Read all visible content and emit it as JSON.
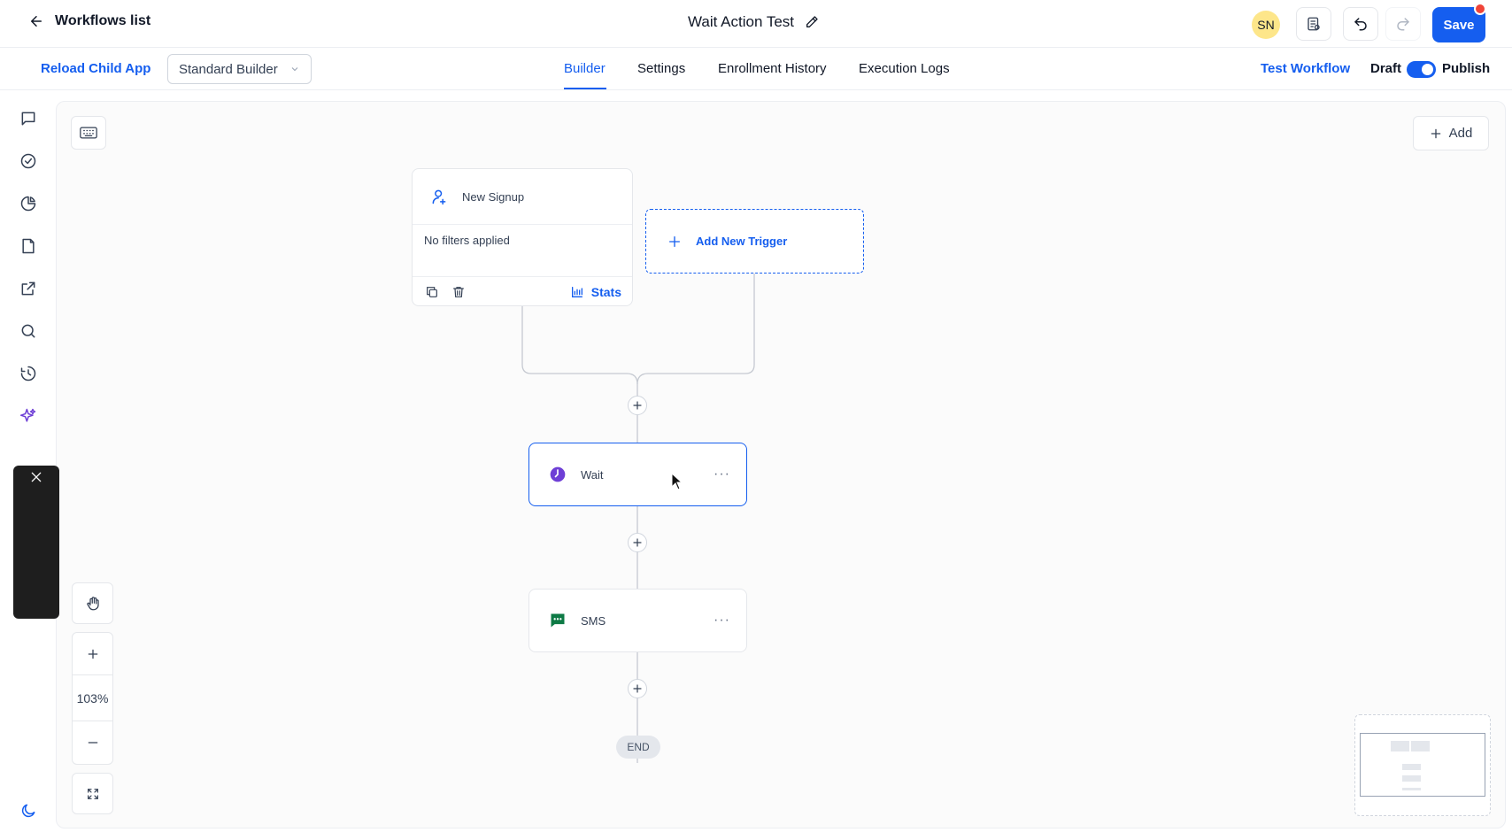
{
  "header": {
    "back_label": "Workflows list",
    "workflow_title": "Wait Action Test",
    "avatar_initials": "SN",
    "save_label": "Save"
  },
  "subbar": {
    "reload_label": "Reload Child App",
    "builder_select_value": "Standard Builder",
    "tabs": [
      {
        "label": "Builder",
        "active": true
      },
      {
        "label": "Settings",
        "active": false
      },
      {
        "label": "Enrollment History",
        "active": false
      },
      {
        "label": "Execution Logs",
        "active": false
      }
    ],
    "test_workflow_label": "Test Workflow",
    "draft_label": "Draft",
    "publish_label": "Publish",
    "publish_toggle_on": true
  },
  "sidebar": {
    "icons": [
      "chat-icon",
      "check-circle-icon",
      "pie-chart-icon",
      "document-icon",
      "external-link-icon",
      "search-icon",
      "history-icon",
      "sparkle-icon",
      "moon-icon"
    ]
  },
  "canvas": {
    "add_label": "Add",
    "trigger": {
      "name": "New Signup",
      "filter_text": "No filters applied",
      "stats_label": "Stats"
    },
    "add_trigger_label": "Add New Trigger",
    "actions": [
      {
        "name": "Wait",
        "icon": "clock-icon",
        "selected": true
      },
      {
        "name": "SMS",
        "icon": "sms-icon",
        "selected": false
      }
    ],
    "end_label": "END",
    "zoom_level": "103%"
  },
  "colors": {
    "accent": "#155eef",
    "wait_icon": "#6e3fd6",
    "sms_icon": "#0d7a45",
    "notification_dot": "#f04438"
  }
}
